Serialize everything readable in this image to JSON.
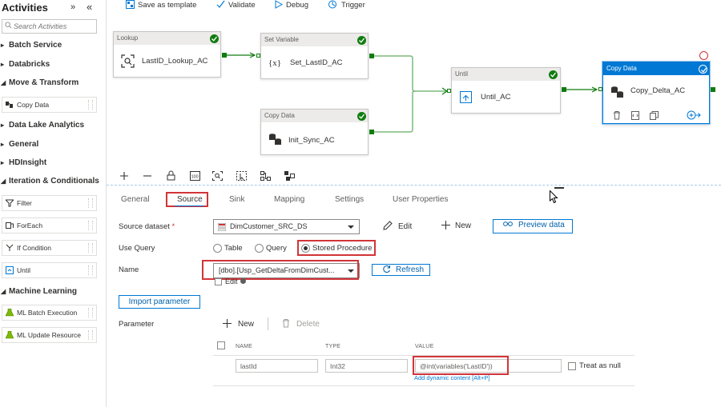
{
  "sidebar": {
    "title": "Activities",
    "collapse_glyph": "»",
    "hide_glyph": "«",
    "search_placeholder": "Search Activities",
    "categories": [
      {
        "label": "Batch Service"
      },
      {
        "label": "Databricks"
      },
      {
        "label": "Move & Transform"
      },
      {
        "label": "Data Lake Analytics"
      },
      {
        "label": "General"
      },
      {
        "label": "HDInsight"
      },
      {
        "label": "Iteration & Conditionals"
      },
      {
        "label": "Machine Learning"
      }
    ],
    "activities": [
      {
        "label": "Copy Data",
        "icon": "copy-data-icon"
      },
      {
        "label": "Filter",
        "icon": "filter-icon"
      },
      {
        "label": "ForEach",
        "icon": "foreach-icon"
      },
      {
        "label": "If Condition",
        "icon": "if-condition-icon"
      },
      {
        "label": "Until",
        "icon": "until-icon"
      },
      {
        "label": "ML Batch Execution",
        "icon": "ml-batch-icon"
      },
      {
        "label": "ML Update Resource",
        "icon": "ml-update-icon"
      }
    ]
  },
  "toolbar": {
    "save_template": "Save as template",
    "validate": "Validate",
    "debug": "Debug",
    "trigger": "Trigger"
  },
  "canvas": {
    "nodes": [
      {
        "type": "Lookup",
        "name": "LastID_Lookup_AC",
        "icon": "lookup-icon",
        "status": "succeeded"
      },
      {
        "type": "Set Variable",
        "name": "Set_LastID_AC",
        "icon": "variable-icon",
        "status": "succeeded"
      },
      {
        "type": "Copy Data",
        "name": "Init_Sync_AC",
        "icon": "copy-data-icon",
        "status": "succeeded"
      },
      {
        "type": "Until",
        "name": "Until_AC",
        "icon": "until-icon",
        "status": "succeeded"
      },
      {
        "type": "Copy Data",
        "name": "Copy_Delta_AC",
        "icon": "copy-data-icon",
        "status": "succeeded",
        "selected": true
      }
    ],
    "tools": [
      "add",
      "remove",
      "lock",
      "fit-100",
      "zoom-fit",
      "select",
      "auto-align",
      "arrange"
    ]
  },
  "panel": {
    "tabs": [
      {
        "label": "General"
      },
      {
        "label": "Source",
        "active": true
      },
      {
        "label": "Sink"
      },
      {
        "label": "Mapping"
      },
      {
        "label": "Settings"
      },
      {
        "label": "User Properties"
      }
    ],
    "source_dataset": {
      "label": "Source dataset",
      "required_mark": "*",
      "value": "DimCustomer_SRC_DS",
      "edit": "Edit",
      "new": "New",
      "preview": "Preview data"
    },
    "use_query": {
      "label": "Use Query",
      "options": [
        "Table",
        "Query",
        "Stored Procedure"
      ],
      "selected": "Stored Procedure"
    },
    "name": {
      "label": "Name",
      "value": "[dbo].[Usp_GetDeltaFromDimCust...",
      "edit": "Edit",
      "refresh": "Refresh"
    },
    "import_parameter": "Import parameter",
    "parameter": {
      "label": "Parameter",
      "new": "New",
      "delete": "Delete",
      "columns": [
        "NAME",
        "TYPE",
        "VALUE"
      ],
      "rows": [
        {
          "name": "lastId",
          "type": "Int32",
          "value": "@int(variables('LastID'))",
          "treat_as_null": "Treat as null"
        }
      ],
      "dynamic_link": "Add dynamic content [Alt+P]"
    }
  },
  "colors": {
    "accent": "#0078d4",
    "success": "#107c10",
    "highlight": "#d13438",
    "selected_header": "#0078d4"
  }
}
